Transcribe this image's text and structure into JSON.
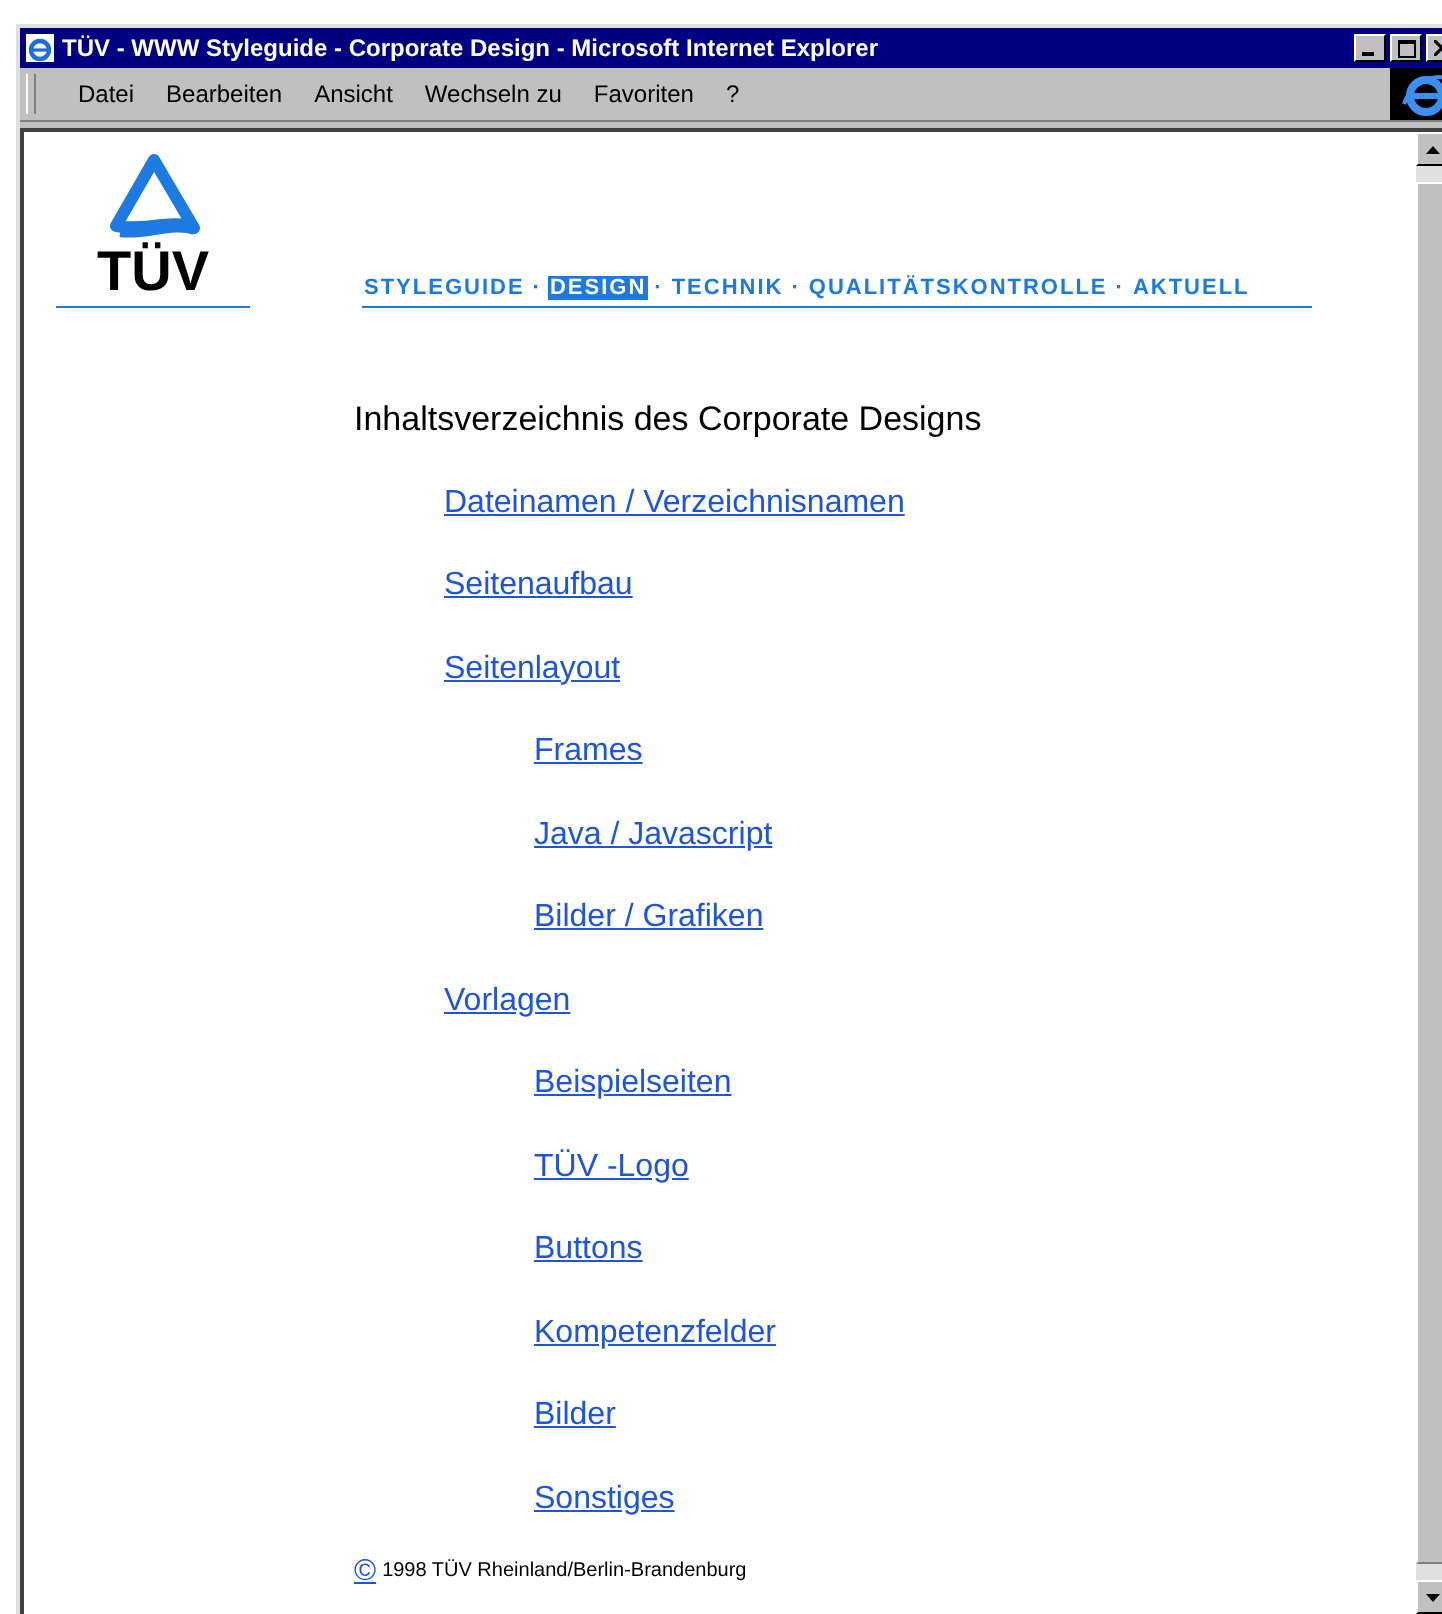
{
  "window": {
    "title": "TÜV - WWW Styleguide - Corporate Design - Microsoft Internet Explorer"
  },
  "menu": [
    "Datei",
    "Bearbeiten",
    "Ansicht",
    "Wechseln zu",
    "Favoriten",
    "?"
  ],
  "logo": {
    "text": "TÜV"
  },
  "nav": {
    "separator": "·",
    "items": [
      {
        "label": "STYLEGUIDE",
        "selected": false
      },
      {
        "label": "DESIGN",
        "selected": true
      },
      {
        "label": "TECHNIK",
        "selected": false
      },
      {
        "label": "QUALITÄTSKONTROLLE",
        "selected": false
      },
      {
        "label": "AKTUELL",
        "selected": false
      }
    ]
  },
  "heading": "Inhaltsverzeichnis des Corporate Designs",
  "toc": [
    {
      "label": "Dateinamen / Verzeichnisnamen"
    },
    {
      "label": "Seitenaufbau"
    },
    {
      "label": "Seitenlayout",
      "children": [
        {
          "label": "Frames"
        },
        {
          "label": "Java / Javascript"
        },
        {
          "label": "Bilder / Grafiken"
        }
      ]
    },
    {
      "label": "Vorlagen",
      "children": [
        {
          "label": "Beispielseiten"
        },
        {
          "label": "TÜV -Logo"
        },
        {
          "label": "Buttons"
        },
        {
          "label": "Kompetenzfelder"
        },
        {
          "label": "Bilder"
        },
        {
          "label": "Sonstiges"
        }
      ]
    }
  ],
  "footer": {
    "symbol": "©",
    "text": "1998 TÜV Rheinland/Berlin-Brandenburg"
  }
}
